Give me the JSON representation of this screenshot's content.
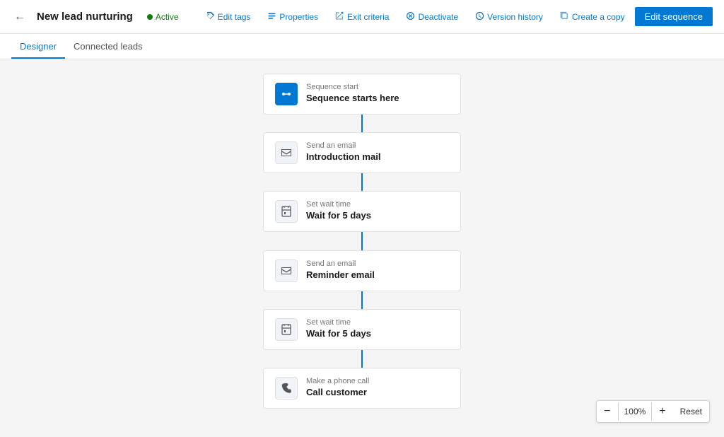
{
  "header": {
    "back_icon": "←",
    "title": "New lead nurturing",
    "status": "Active",
    "actions": [
      {
        "id": "edit-tags",
        "icon": "🏷",
        "label": "Edit tags"
      },
      {
        "id": "properties",
        "icon": "📄",
        "label": "Properties"
      },
      {
        "id": "exit-criteria",
        "icon": "↗",
        "label": "Exit criteria"
      },
      {
        "id": "deactivate",
        "icon": "⚙",
        "label": "Deactivate"
      },
      {
        "id": "version-history",
        "icon": "🕐",
        "label": "Version history"
      },
      {
        "id": "create-a-copy",
        "icon": "📋",
        "label": "Create a copy"
      }
    ],
    "edit_sequence_label": "Edit sequence"
  },
  "tabs": [
    {
      "id": "designer",
      "label": "Designer",
      "active": true
    },
    {
      "id": "connected-leads",
      "label": "Connected leads",
      "active": false
    }
  ],
  "nodes": [
    {
      "id": "sequence-start",
      "icon_type": "blue",
      "icon": "⚙",
      "label": "Sequence start",
      "title": "Sequence starts here"
    },
    {
      "id": "send-email-1",
      "icon_type": "gray",
      "icon": "✉",
      "label": "Send an email",
      "title": "Introduction mail"
    },
    {
      "id": "wait-time-1",
      "icon_type": "gray",
      "icon": "⏱",
      "label": "Set wait time",
      "title": "Wait for 5 days"
    },
    {
      "id": "send-email-2",
      "icon_type": "gray",
      "icon": "✉",
      "label": "Send an email",
      "title": "Reminder email"
    },
    {
      "id": "wait-time-2",
      "icon_type": "gray",
      "icon": "⏱",
      "label": "Set wait time",
      "title": "Wait for 5 days"
    },
    {
      "id": "phone-call",
      "icon_type": "gray",
      "icon": "📞",
      "label": "Make a phone call",
      "title": "Call customer"
    }
  ],
  "zoom": {
    "minus": "−",
    "plus": "+",
    "level": "100%",
    "reset": "Reset"
  }
}
